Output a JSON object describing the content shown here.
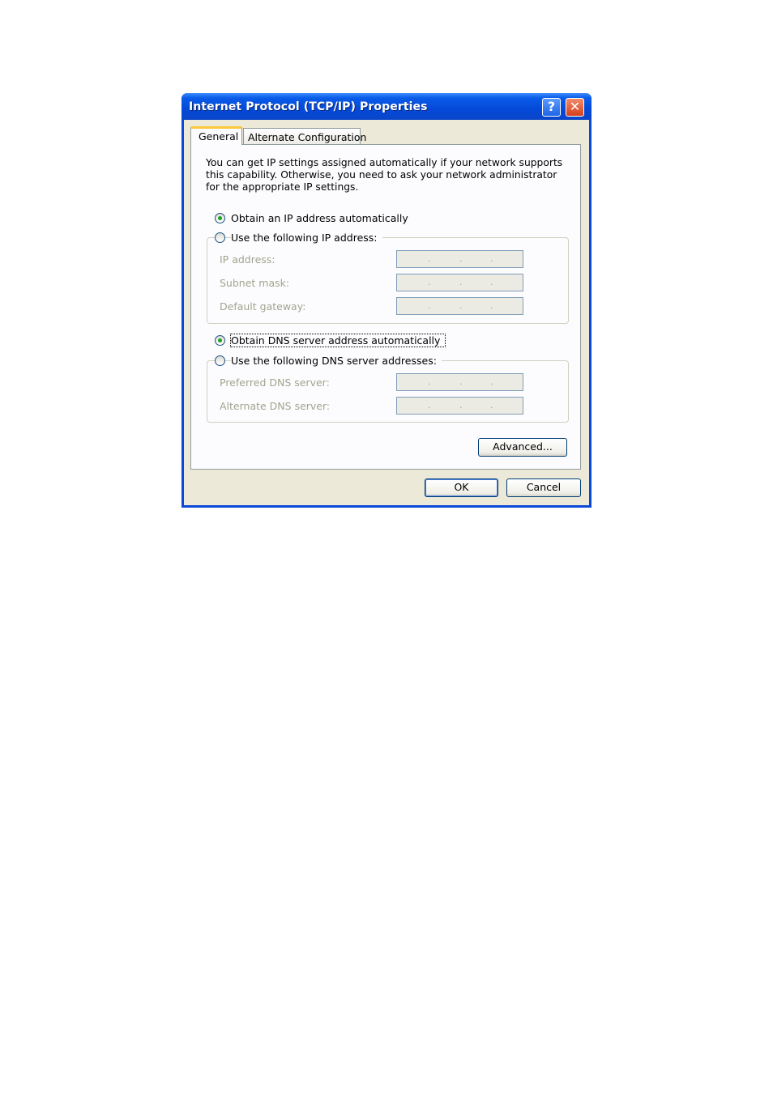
{
  "window": {
    "title": "Internet Protocol (TCP/IP) Properties",
    "help_glyph": "?",
    "close_glyph": "✕"
  },
  "tabs": [
    {
      "label": "General",
      "selected": true
    },
    {
      "label": "Alternate Configuration",
      "selected": false
    }
  ],
  "description": "You can get IP settings assigned automatically if your network supports this capability. Otherwise, you need to ask your network administrator for the appropriate IP settings.",
  "ip_section": {
    "auto_label": "Obtain an IP address automatically",
    "auto_selected": true,
    "manual_label": "Use the following IP address:",
    "fields": [
      {
        "label": "IP address:"
      },
      {
        "label": "Subnet mask:"
      },
      {
        "label": "Default gateway:"
      }
    ]
  },
  "dns_section": {
    "auto_label": "Obtain DNS server address automatically",
    "auto_selected": true,
    "manual_label": "Use the following DNS server addresses:",
    "fields": [
      {
        "label": "Preferred DNS server:"
      },
      {
        "label": "Alternate DNS server:"
      }
    ]
  },
  "ip_separator": ".",
  "buttons": {
    "advanced": "Advanced...",
    "ok": "OK",
    "cancel": "Cancel"
  },
  "colors": {
    "titlebar": "#0549d9",
    "selected_tab_accent": "#ffc83c",
    "radio_dot": "#21a121"
  }
}
